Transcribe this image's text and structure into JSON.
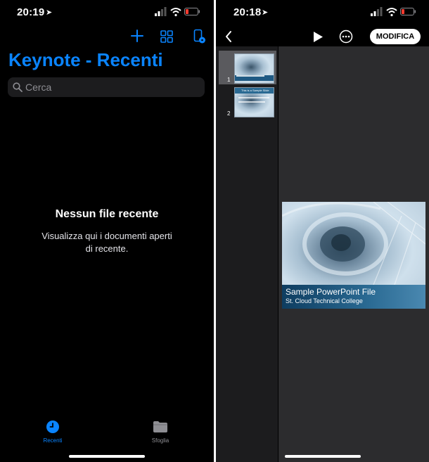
{
  "left": {
    "status": {
      "time": "20:19"
    },
    "title": "Keynote - Recenti",
    "search": {
      "placeholder": "Cerca"
    },
    "empty": {
      "title": "Nessun file recente",
      "subtitle_line1": "Visualizza qui i documenti aperti",
      "subtitle_line2": "di recente."
    },
    "tabs": [
      {
        "label": "Recenti"
      },
      {
        "label": "Sfoglia"
      }
    ],
    "accent": "#0a84ff"
  },
  "right": {
    "status": {
      "time": "20:18"
    },
    "edit_label": "MODIFICA",
    "slides": [
      {
        "number": "1"
      },
      {
        "number": "2"
      }
    ],
    "slide2_thumb_title": "This is a Sample Slide",
    "current_slide": {
      "title": "Sample PowerPoint File",
      "subtitle": "St. Cloud Technical College"
    }
  }
}
